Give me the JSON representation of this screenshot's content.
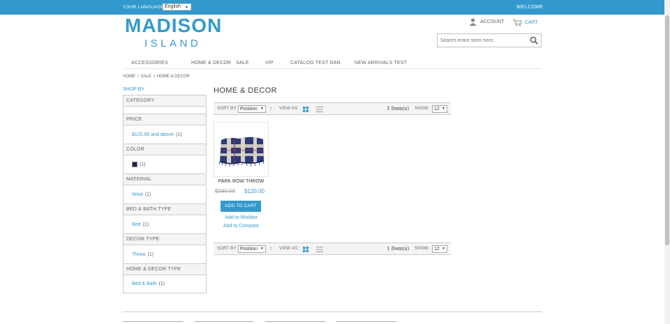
{
  "topbar": {
    "language_label": "YOUR LANGUAGE:",
    "language_value": "English",
    "welcome": "WELCOME"
  },
  "logo": {
    "line1": "MADISON",
    "line2": "ISLAND"
  },
  "header": {
    "account_label": "ACCOUNT",
    "cart_label": "CART",
    "search_placeholder": "Search entire store here..."
  },
  "nav": [
    "ACCESSORIES",
    "HOME & DECOR",
    "SALE",
    "VIP",
    "CATALOG TEST DAN",
    "NEW ARRIVALS TEST"
  ],
  "breadcrumb": [
    "HOME",
    "SALE",
    "HOME & DECOR"
  ],
  "breadcrumb_sep": "/",
  "shop_by": "SHOP BY",
  "filters": {
    "category": {
      "title": "CATEGORY"
    },
    "price": {
      "title": "PRICE",
      "option": "$120.00 and above",
      "count": "(1)"
    },
    "color": {
      "title": "COLOR",
      "count": "(1)",
      "swatch": "#1f2340"
    },
    "material": {
      "title": "MATERIAL",
      "option": "Wool",
      "count": "(1)"
    },
    "bed_bath_type": {
      "title": "BED & BATH TYPE",
      "option": "Bed",
      "count": "(1)"
    },
    "decor_type": {
      "title": "DECOR TYPE",
      "option": "Throw",
      "count": "(1)"
    },
    "home_decor_type": {
      "title": "HOME & DECOR TYPE",
      "option": "Bed & Bath",
      "count": "(1)"
    }
  },
  "page_title": "HOME & DECOR",
  "toolbar": {
    "sort_label": "SORT BY:",
    "sort_value": "Position",
    "view_label": "VIEW AS:",
    "items_count": "1 Item(s)",
    "show_label": "SHOW:",
    "show_value": "12"
  },
  "product": {
    "name": "PARK ROW THROW",
    "old_price": "$240.00",
    "new_price": "$120.00",
    "add_to_cart": "ADD TO CART",
    "wishlist": "Add to Wishlist",
    "compare": "Add to Compare"
  },
  "colors": {
    "accent": "#3399cc",
    "text": "#636363"
  }
}
